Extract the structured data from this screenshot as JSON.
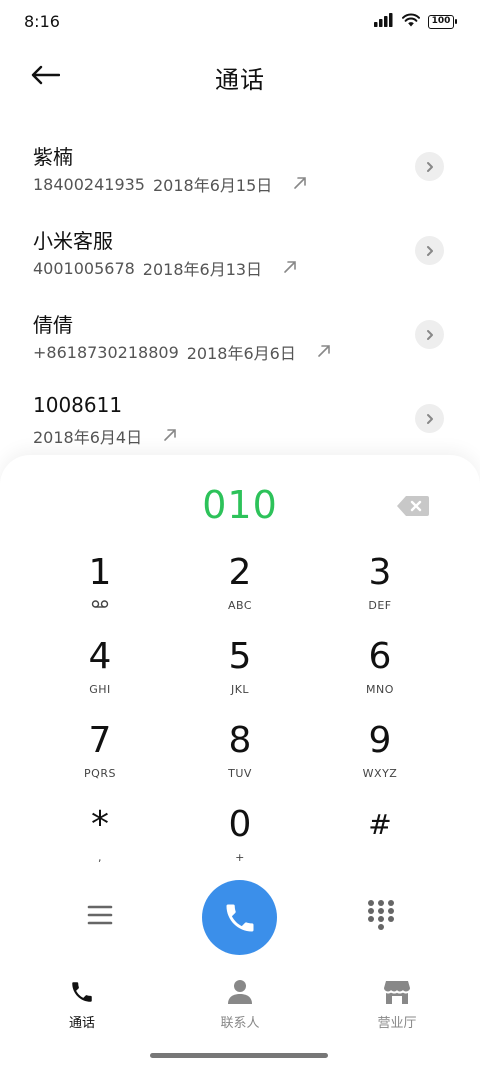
{
  "status_bar": {
    "time": "8:16",
    "battery": "100"
  },
  "header": {
    "title": "通话"
  },
  "calls": [
    {
      "name": "紫楠",
      "number": "18400241935",
      "date": "2018年6月15日"
    },
    {
      "name": "小米客服",
      "number": "4001005678",
      "date": "2018年6月13日"
    },
    {
      "name": "倩倩",
      "number": "+8618730218809",
      "date": "2018年6月6日"
    },
    {
      "name": "1008611",
      "number": "",
      "date": "2018年6月4日"
    }
  ],
  "dialer": {
    "input": "010",
    "keys": [
      {
        "digit": "1",
        "letters": ""
      },
      {
        "digit": "2",
        "letters": "ABC"
      },
      {
        "digit": "3",
        "letters": "DEF"
      },
      {
        "digit": "4",
        "letters": "GHI"
      },
      {
        "digit": "5",
        "letters": "JKL"
      },
      {
        "digit": "6",
        "letters": "MNO"
      },
      {
        "digit": "7",
        "letters": "PQRS"
      },
      {
        "digit": "8",
        "letters": "TUV"
      },
      {
        "digit": "9",
        "letters": "WXYZ"
      },
      {
        "digit": "*",
        "letters": ","
      },
      {
        "digit": "0",
        "letters": "+"
      },
      {
        "digit": "#",
        "letters": ""
      }
    ]
  },
  "nav": {
    "tabs": [
      {
        "label": "通话",
        "icon": "phone-icon"
      },
      {
        "label": "联系人",
        "icon": "person-icon"
      },
      {
        "label": "营业厅",
        "icon": "store-icon"
      }
    ]
  },
  "colors": {
    "accent_green": "#2dc25a",
    "call_blue": "#3b8fea"
  }
}
